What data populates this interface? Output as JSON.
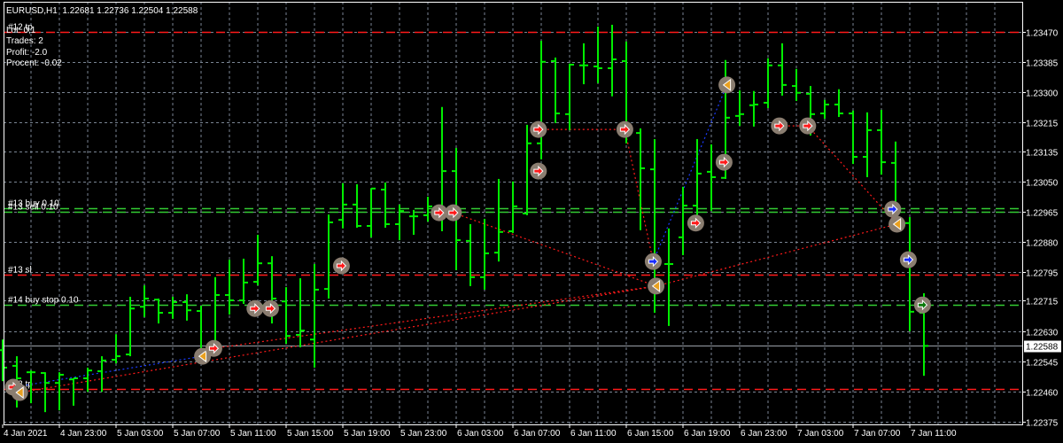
{
  "header": {
    "symbol": "EURUSD,H1",
    "ohlc": "1.22681 1.22736 1.22504 1.22588"
  },
  "stats": {
    "lot": "Lot: 0,1",
    "trades": "Trades: 2",
    "profit": "Profit: -2.0",
    "procent": "Procent: -0.02"
  },
  "colors": {
    "background": "#000000",
    "bar": "#00ee00",
    "grid": "#7a8593",
    "tp_sl_line": "#ff1a1a",
    "order_line": "#33cc33",
    "bid_line": "#9aa0a8",
    "marker_bg": "#8a7d70"
  },
  "chart_data": {
    "type": "ohlc",
    "title": "EURUSD,H1",
    "ylim": [
      1.22375,
      1.2347
    ],
    "price_ticks": [
      "1.23470",
      "1.23385",
      "1.23300",
      "1.23215",
      "1.23135",
      "1.23050",
      "1.22965",
      "1.22880",
      "1.22795",
      "1.22715",
      "1.22630",
      "1.22545",
      "1.22460",
      "1.22375"
    ],
    "current_price": "1.22588",
    "time_labels": [
      "4 Jan 2021",
      "4 Jan 23:00",
      "5 Jan 03:00",
      "5 Jan 07:00",
      "5 Jan 11:00",
      "5 Jan 15:00",
      "5 Jan 19:00",
      "5 Jan 23:00",
      "6 Jan 03:00",
      "6 Jan 07:00",
      "6 Jan 11:00",
      "6 Jan 15:00",
      "6 Jan 19:00",
      "6 Jan 23:00",
      "7 Jan 03:00",
      "7 Jan 07:00",
      "7 Jan 11:00"
    ],
    "bars_per_label": 4,
    "bars": [
      [
        1.22576,
        1.22606,
        1.22489,
        1.22527
      ],
      [
        1.22532,
        1.22559,
        1.22415,
        1.22497
      ],
      [
        1.22514,
        1.22519,
        1.22427,
        1.22514
      ],
      [
        1.22512,
        1.22514,
        1.22402,
        1.22484
      ],
      [
        1.22484,
        1.22514,
        1.22407,
        1.22507
      ],
      [
        1.22494,
        1.22497,
        1.2242,
        1.22497
      ],
      [
        1.22497,
        1.22527,
        1.22459,
        1.22519
      ],
      [
        1.22517,
        1.22559,
        1.22459,
        1.22547
      ],
      [
        1.22549,
        1.22621,
        1.22539,
        1.22559
      ],
      [
        1.22564,
        1.22726,
        1.22559,
        1.22693
      ],
      [
        1.22698,
        1.22758,
        1.22669,
        1.22721
      ],
      [
        1.22718,
        1.22721,
        1.22651,
        1.22681
      ],
      [
        1.22681,
        1.22726,
        1.22664,
        1.22711
      ],
      [
        1.22711,
        1.22733,
        1.22659,
        1.22688
      ],
      [
        1.22686,
        1.22701,
        1.22539,
        1.22564
      ],
      [
        1.22581,
        1.22781,
        1.22559,
        1.22731
      ],
      [
        1.22731,
        1.2283,
        1.22676,
        1.22716
      ],
      [
        1.22716,
        1.22833,
        1.22706,
        1.22766
      ],
      [
        1.22768,
        1.229,
        1.22758,
        1.2282
      ],
      [
        1.2282,
        1.2284,
        1.22651,
        1.22721
      ],
      [
        1.22713,
        1.22753,
        1.22594,
        1.22616
      ],
      [
        1.22619,
        1.22778,
        1.22584,
        1.22631
      ],
      [
        1.22606,
        1.22818,
        1.22527,
        1.22746
      ],
      [
        1.22748,
        1.22957,
        1.22721,
        1.22935
      ],
      [
        1.22942,
        1.23045,
        1.22918,
        1.22985
      ],
      [
        1.22985,
        1.23042,
        1.2292,
        1.22925
      ],
      [
        1.22925,
        1.2303,
        1.22893,
        1.2303
      ],
      [
        1.23027,
        1.23047,
        1.2292,
        1.2293
      ],
      [
        1.2293,
        1.22985,
        1.22885,
        1.22967
      ],
      [
        1.22952,
        1.2297,
        1.229,
        1.22952
      ],
      [
        1.22955,
        1.23007,
        1.22937,
        1.2298
      ],
      [
        1.22982,
        1.23259,
        1.2291,
        1.23079
      ],
      [
        1.23079,
        1.23144,
        1.22801,
        1.22885
      ],
      [
        1.22883,
        1.2293,
        1.22756,
        1.22781
      ],
      [
        1.22781,
        1.22945,
        1.22746,
        1.22848
      ],
      [
        1.2285,
        1.23057,
        1.22825,
        1.22908
      ],
      [
        1.2291,
        1.2305,
        1.22905,
        1.2298
      ],
      [
        1.2296,
        1.23209,
        1.22955,
        1.23157
      ],
      [
        1.23157,
        1.23445,
        1.23112,
        1.23386
      ],
      [
        1.23388,
        1.23398,
        1.23214,
        1.23241
      ],
      [
        1.23239,
        1.23381,
        1.23194,
        1.23378
      ],
      [
        1.23376,
        1.23438,
        1.23323,
        1.23376
      ],
      [
        1.23373,
        1.23485,
        1.23326,
        1.23368
      ],
      [
        1.23368,
        1.2349,
        1.23289,
        1.23393
      ],
      [
        1.23388,
        1.23443,
        1.23157,
        1.23186
      ],
      [
        1.23186,
        1.23199,
        1.22913,
        1.23087
      ],
      [
        1.23084,
        1.23169,
        1.22681,
        1.22818
      ],
      [
        1.22818,
        1.22918,
        1.22644,
        1.22818
      ],
      [
        1.22893,
        1.23035,
        1.22843,
        1.22982
      ],
      [
        1.22982,
        1.23169,
        1.22955,
        1.23072
      ],
      [
        1.23077,
        1.23154,
        1.22967,
        1.23062
      ],
      [
        1.2306,
        1.23391,
        1.23057,
        1.23229
      ],
      [
        1.23234,
        1.23306,
        1.23206,
        1.23239
      ],
      [
        1.23264,
        1.23304,
        1.23204,
        1.23266
      ],
      [
        1.23271,
        1.23396,
        1.23256,
        1.23376
      ],
      [
        1.23376,
        1.23438,
        1.23291,
        1.23321
      ],
      [
        1.23318,
        1.23366,
        1.23276,
        1.23299
      ],
      [
        1.23296,
        1.23318,
        1.23179,
        1.23239
      ],
      [
        1.23241,
        1.23279,
        1.23226,
        1.23266
      ],
      [
        1.23266,
        1.23309,
        1.23231,
        1.23241
      ],
      [
        1.23241,
        1.23249,
        1.23099,
        1.23119
      ],
      [
        1.23119,
        1.23244,
        1.23062,
        1.23194
      ],
      [
        1.23194,
        1.23251,
        1.23069,
        1.23104
      ],
      [
        1.23102,
        1.23162,
        1.2292,
        1.22933
      ],
      [
        1.22933,
        1.2295,
        1.22629,
        1.22684
      ],
      [
        1.22681,
        1.22736,
        1.22504,
        1.22588
      ]
    ],
    "order_lines": [
      {
        "label": "#12 tp",
        "price": 1.2347,
        "kind": "tp"
      },
      {
        "label": "#13 buy 0.10",
        "price": 1.22975,
        "kind": "order"
      },
      {
        "label": "#13 sell 0.10",
        "price": 1.22965,
        "kind": "order"
      },
      {
        "label": "#13 sl",
        "price": 1.22788,
        "kind": "sl"
      },
      {
        "label": "#14 buy stop 0.10",
        "price": 1.22703,
        "kind": "order"
      },
      {
        "label": "#13 tp",
        "price": 1.22467,
        "kind": "tp"
      }
    ],
    "trade_markers": [
      {
        "bar": 0.75,
        "price": 1.22472,
        "type": "red"
      },
      {
        "bar": 1.2,
        "price": 1.22457,
        "type": "orange"
      },
      {
        "bar": 14.1,
        "price": 1.22559,
        "type": "orange"
      },
      {
        "bar": 14.9,
        "price": 1.22581,
        "type": "red"
      },
      {
        "bar": 17.8,
        "price": 1.22693,
        "type": "red"
      },
      {
        "bar": 18.9,
        "price": 1.22693,
        "type": "red"
      },
      {
        "bar": 23.9,
        "price": 1.22813,
        "type": "red"
      },
      {
        "bar": 30.8,
        "price": 1.22962,
        "type": "red"
      },
      {
        "bar": 31.8,
        "price": 1.22962,
        "type": "red"
      },
      {
        "bar": 37.8,
        "price": 1.23196,
        "type": "red"
      },
      {
        "bar": 37.8,
        "price": 1.23079,
        "type": "red"
      },
      {
        "bar": 43.9,
        "price": 1.23196,
        "type": "red"
      },
      {
        "bar": 45.9,
        "price": 1.22825,
        "type": "blue"
      },
      {
        "bar": 46.1,
        "price": 1.22756,
        "type": "orange"
      },
      {
        "bar": 48.9,
        "price": 1.22933,
        "type": "red"
      },
      {
        "bar": 50.9,
        "price": 1.23104,
        "type": "red"
      },
      {
        "bar": 51.1,
        "price": 1.23321,
        "type": "orange"
      },
      {
        "bar": 54.8,
        "price": 1.23206,
        "type": "red"
      },
      {
        "bar": 56.8,
        "price": 1.23206,
        "type": "red"
      },
      {
        "bar": 62.8,
        "price": 1.22972,
        "type": "blue"
      },
      {
        "bar": 63.1,
        "price": 1.2293,
        "type": "orange"
      },
      {
        "bar": 63.9,
        "price": 1.2283,
        "type": "blue"
      },
      {
        "bar": 64.9,
        "price": 1.22703,
        "type": "green"
      }
    ],
    "trade_links": [
      {
        "from": 0,
        "to": 2,
        "color": "blue"
      },
      {
        "from": 1,
        "to": 13,
        "color": "red"
      },
      {
        "from": 3,
        "to": 13,
        "color": "red"
      },
      {
        "from": 8,
        "to": 13,
        "color": "red"
      },
      {
        "from": 9,
        "to": 11,
        "color": "red"
      },
      {
        "from": 11,
        "to": 12,
        "color": "red"
      },
      {
        "from": 12,
        "to": 16,
        "color": "blue"
      },
      {
        "from": 17,
        "to": 18,
        "color": "red"
      },
      {
        "from": 18,
        "to": 20,
        "color": "red"
      },
      {
        "from": 13,
        "to": 20,
        "color": "red"
      }
    ]
  }
}
